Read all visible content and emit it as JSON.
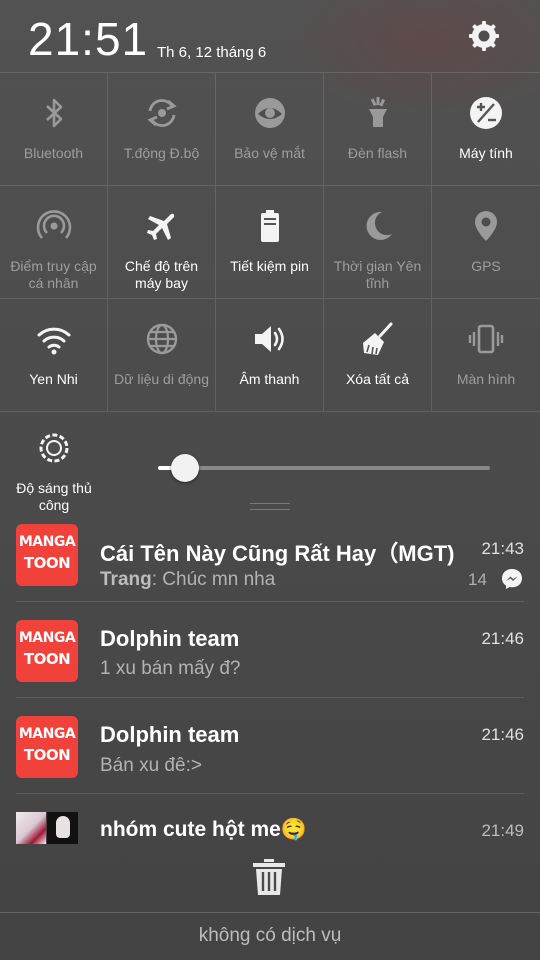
{
  "status": {
    "time": "21:51",
    "date": "Th 6, 12 tháng 6"
  },
  "quick_settings": [
    {
      "label": "Bluetooth",
      "icon": "bluetooth-icon",
      "active": false
    },
    {
      "label": "T.động Đ.bộ",
      "icon": "sync-icon",
      "active": false
    },
    {
      "label": "Bảo vệ mắt",
      "icon": "eye-icon",
      "active": false
    },
    {
      "label": "Đèn flash",
      "icon": "flashlight-icon",
      "active": false
    },
    {
      "label": "Máy tính",
      "icon": "calculator-icon",
      "active": true
    },
    {
      "label": "Điểm truy cập\ncá nhân",
      "icon": "hotspot-icon",
      "active": false
    },
    {
      "label": "Chế độ trên\nmáy bay",
      "icon": "airplane-icon",
      "active": true
    },
    {
      "label": "Tiết kiệm pin",
      "icon": "battery-icon",
      "active": true
    },
    {
      "label": "Thời gian Yên\ntĩnh",
      "icon": "moon-icon",
      "active": false
    },
    {
      "label": "GPS",
      "icon": "location-pin-icon",
      "active": false
    },
    {
      "label": "Yen Nhi",
      "icon": "wifi-icon",
      "active": true
    },
    {
      "label": "Dữ liệu di động",
      "icon": "globe-icon",
      "active": false
    },
    {
      "label": "Âm thanh",
      "icon": "speaker-icon",
      "active": true
    },
    {
      "label": "Xóa tất cả",
      "icon": "broom-icon",
      "active": true
    },
    {
      "label": "Màn hình",
      "icon": "vibrate-icon",
      "active": false
    }
  ],
  "brightness": {
    "label": "Độ sáng thủ\ncông",
    "level": 0.08
  },
  "notifications": [
    {
      "app": "MangaToon",
      "icon_line1": "MANGA",
      "icon_line2": "TOON",
      "title": "Cái Tên Này Cũng Rất Hay（MGT)",
      "sender": "Trang",
      "text": ": Chúc mn nha",
      "time": "21:43",
      "count": "14"
    },
    {
      "app": "MangaToon",
      "icon_line1": "MANGA",
      "icon_line2": "TOON",
      "title": "Dolphin team",
      "text": "1 xu bán mấy đ?",
      "time": "21:46"
    },
    {
      "app": "MangaToon",
      "icon_line1": "MANGA",
      "icon_line2": "TOON",
      "title": "Dolphin team",
      "text": "Bán xu đê:>",
      "time": "21:46"
    },
    {
      "title": "nhóm cute hột me🤤",
      "time": "21:49"
    }
  ],
  "footer": {
    "text": "không có dịch vụ"
  },
  "colors": {
    "manga_red": "#f0423a",
    "active_label": "#ffffff",
    "inactive_label": "#9e9e9e"
  }
}
